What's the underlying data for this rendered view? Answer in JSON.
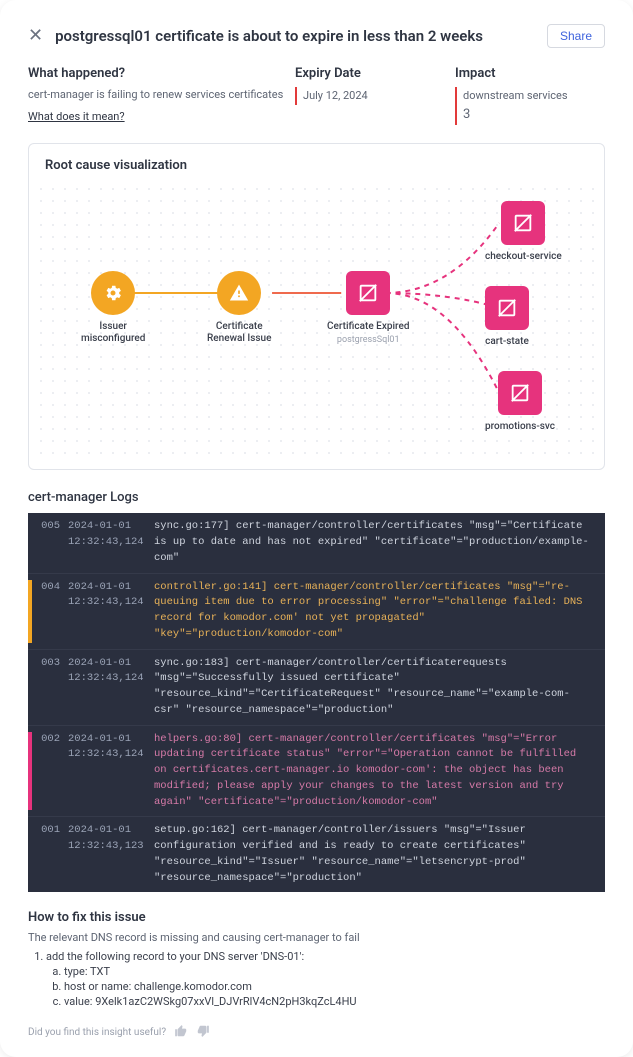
{
  "header": {
    "title": "postgressql01 certificate is about to expire in less than 2 weeks",
    "share_label": "Share"
  },
  "summary": {
    "what_title": "What happened?",
    "what_desc": "cert-manager is failing to renew services certificates",
    "what_link": "What does it mean?",
    "expiry_title": "Expiry Date",
    "expiry_value": "July 12, 2024",
    "impact_title": "Impact",
    "impact_desc": "downstream services",
    "impact_count": "3"
  },
  "viz": {
    "title": "Root cause visualization",
    "nodes": {
      "issuer": {
        "label": "Issuer\nmisconfigured"
      },
      "renewal": {
        "label": "Certificate\nRenewal Issue"
      },
      "expired": {
        "label": "Certificate Expired",
        "sub": "postgressSql01"
      },
      "svc1": {
        "label": "checkout-service"
      },
      "svc2": {
        "label": "cart-state"
      },
      "svc3": {
        "label": "promotions-svc"
      }
    }
  },
  "logs": {
    "title": "cert-manager Logs",
    "rows": [
      {
        "idx": "005",
        "date": "2024-01-01",
        "time": "12:32:43,124",
        "level": "info",
        "msg": "sync.go:177] cert-manager/controller/certificates \"msg\"=\"Certificate is up to date and has not expired\" \"certificate\"=\"production/example-com\""
      },
      {
        "idx": "004",
        "date": "2024-01-01",
        "time": "12:32:43,124",
        "level": "warn",
        "msg": "controller.go:141] cert-manager/controller/certificates \"msg\"=\"re-queuing item due to error processing\" \"error\"=\"challenge failed: DNS record for komodor.com' not yet propagated\" \"key\"=\"production/komodor-com\""
      },
      {
        "idx": "003",
        "date": "2024-01-01",
        "time": "12:32:43,124",
        "level": "info",
        "msg": "sync.go:183] cert-manager/controller/certificaterequests \"msg\"=\"Successfully issued certificate\" \"resource_kind\"=\"CertificateRequest\" \"resource_name\"=\"example-com-csr\" \"resource_namespace\"=\"production\""
      },
      {
        "idx": "002",
        "date": "2024-01-01",
        "time": "12:32:43,124",
        "level": "err",
        "msg": "helpers.go:80] cert-manager/controller/certificates \"msg\"=\"Error updating certificate status\" \"error\"=\"Operation cannot be fulfilled on certificates.cert-manager.io komodor-com': the object has been modified; please apply your changes to the latest version and try again\" \"certificate\"=\"production/komodor-com\""
      },
      {
        "idx": "001",
        "date": "2024-01-01",
        "time": "12:32:43,123",
        "level": "info",
        "msg": "setup.go:162] cert-manager/controller/issuers \"msg\"=\"Issuer configuration verified and is ready to create certificates\" \"resource_kind\"=\"Issuer\" \"resource_name\"=\"letsencrypt-prod\" \"resource_namespace\"=\"production\""
      }
    ]
  },
  "howto": {
    "title": "How to fix this issue",
    "desc": "The relevant DNS record is missing and causing cert-manager to fail",
    "step1": "add the following record to your DNS server 'DNS-01':",
    "step1a": "type: TXT",
    "step1b": "host or name: challenge.komodor.com",
    "step1c": "value: 9Xelk1azC2WSkg07xxVl_DJVrRlV4cN2pH3kqZcL4HU"
  },
  "feedback": {
    "prompt": "Did you find this insight useful?"
  }
}
